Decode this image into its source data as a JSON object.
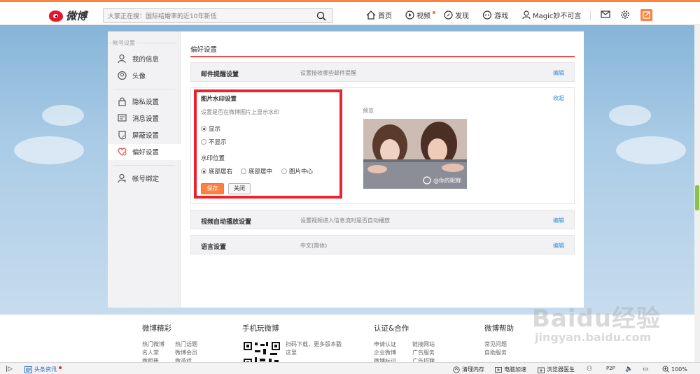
{
  "topbar": {
    "logo_text": "微博",
    "search_placeholder": "大家正在搜：国际结婚率的近10年新低",
    "nav": [
      {
        "label": "首页",
        "icon": "home-icon"
      },
      {
        "label": "视频",
        "icon": "video-icon"
      },
      {
        "label": "发现",
        "icon": "discover-icon"
      },
      {
        "label": "游戏",
        "icon": "game-icon"
      },
      {
        "label": "Magic妙不可言",
        "icon": "user-icon"
      }
    ]
  },
  "sidebar": {
    "section_title": "帐号设置",
    "items": [
      {
        "label": "我的信息",
        "icon": "user-info-icon"
      },
      {
        "label": "头像",
        "icon": "avatar-icon"
      },
      {
        "label": "隐私设置",
        "icon": "lock-icon"
      },
      {
        "label": "消息设置",
        "icon": "message-icon"
      },
      {
        "label": "屏蔽设置",
        "icon": "block-icon"
      },
      {
        "label": "偏好设置",
        "icon": "heart-settings-icon"
      },
      {
        "label": "帐号绑定",
        "icon": "account-bind-icon"
      }
    ]
  },
  "main": {
    "title": "偏好设置",
    "email": {
      "title": "邮件提醒设置",
      "desc": "设置接收哪些邮件提醒",
      "action": "编辑"
    },
    "watermark": {
      "title": "图片水印设置",
      "subtitle": "设置是否在微博图片上显示水印",
      "show": "显示",
      "hide": "不显示",
      "position_title": "水印位置",
      "positions": [
        "底部居右",
        "底部居中",
        "图片中心"
      ],
      "save": "保存",
      "close": "关闭",
      "collapse": "收起",
      "preview_label": "预览",
      "preview_watermark": "@你的昵称"
    },
    "video": {
      "title": "视频自动播放设置",
      "desc": "设置视频进入信息流时是否自动播放",
      "action": "编辑"
    },
    "language": {
      "title": "语言设置",
      "desc": "中文(简体)",
      "action": "编辑"
    }
  },
  "footer": {
    "col1": {
      "title": "微博精彩",
      "links": [
        "热门微博",
        "热门话题",
        "名人堂",
        "微博会员",
        "微相册",
        "微游戏"
      ]
    },
    "col2": {
      "title": "手机玩微博",
      "desc": "扫码下载，更多版本戳这里"
    },
    "col3": {
      "title": "认证&合作",
      "links": [
        "申请认证",
        "链接网站",
        "企业微博",
        "广告服务",
        "微博标识",
        "广告招聘"
      ]
    },
    "col4": {
      "title": "微博帮助",
      "links": [
        "常见问题",
        "自助服务"
      ]
    }
  },
  "statusbar": {
    "news": "头条资讯",
    "clean": "清理内存",
    "speed": "电脑加速",
    "doctor": "浏览器医生",
    "zoom": "100%"
  },
  "watermark_site": {
    "big": "Baidu经验",
    "small": "jingyan.baidu.com"
  }
}
